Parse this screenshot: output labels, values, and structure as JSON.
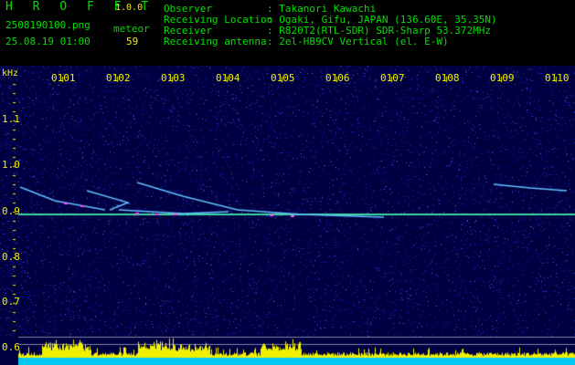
{
  "app": {
    "title": "H R O F F T",
    "version": "1.0.0"
  },
  "file": {
    "name": "2508190100.png",
    "datetime": "25.08.19 01:00"
  },
  "meteor": {
    "label": "meteor",
    "count": "59"
  },
  "info": [
    {
      "label": "Observer",
      "value": ": Takanori Kawachi"
    },
    {
      "label": "Receiving Location",
      "value": ": Ogaki, Gifu, JAPAN (136.60E, 35.35N)"
    },
    {
      "label": "Receiver",
      "value": ": R820T2(RTL-SDR) SDR-Sharp 53.372MHz"
    },
    {
      "label": "Receiving antenna",
      "value": ": 2el-HB9CV Vertical (el. E-W)"
    }
  ],
  "axis": {
    "unit": "kHz",
    "time_ticks": [
      "0101",
      "0102",
      "0103",
      "0104",
      "0105",
      "0106",
      "0107",
      "0108",
      "0109",
      "0110"
    ],
    "freq_ticks": [
      "1.1",
      "1.0",
      "0.9",
      "0.8",
      "0.7",
      "0.6"
    ]
  },
  "colors": {
    "label_green": "#00e000",
    "label_yellow": "#f0f000",
    "carrier": "#3cd6a0",
    "bg_blue": "#000060"
  }
}
